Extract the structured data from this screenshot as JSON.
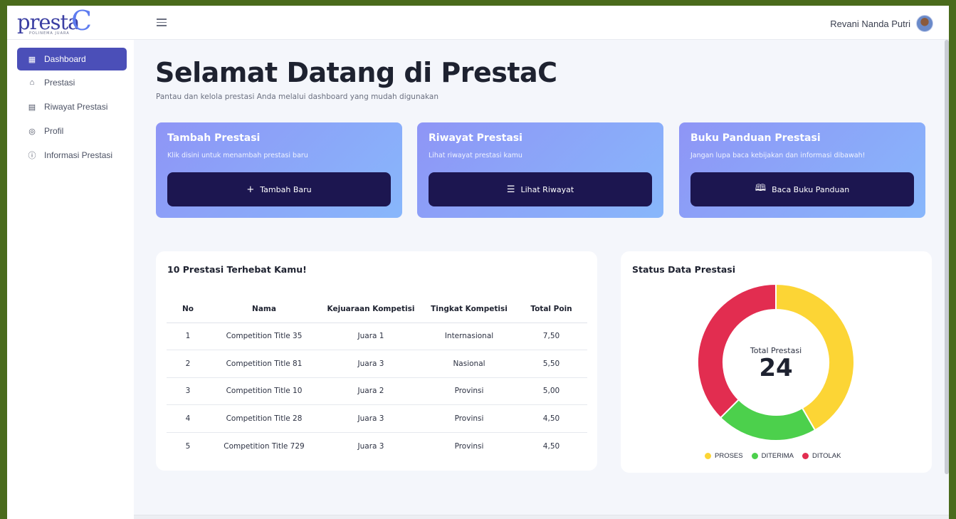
{
  "brand": {
    "name": "presta",
    "letter": "C",
    "tagline": "POLINEMA JUARA"
  },
  "user": {
    "name": "Revani Nanda Putri"
  },
  "sidebar": {
    "items": [
      {
        "label": "Dashboard",
        "icon": "grid-icon",
        "active": true
      },
      {
        "label": "Prestasi",
        "icon": "graduation-cap-icon"
      },
      {
        "label": "Riwayat Prestasi",
        "icon": "history-icon"
      },
      {
        "label": "Profil",
        "icon": "user-circle-icon"
      },
      {
        "label": "Informasi Prestasi",
        "icon": "info-icon"
      }
    ]
  },
  "header": {
    "title": "Selamat Datang di PrestaC",
    "subtitle": "Pantau dan kelola prestasi Anda melalui dashboard yang mudah digunakan"
  },
  "cards": [
    {
      "title": "Tambah Prestasi",
      "desc": "Klik disini untuk menambah prestasi baru",
      "button": "Tambah Baru",
      "icon": "+"
    },
    {
      "title": "Riwayat Prestasi",
      "desc": "Lihat riwayat prestasi kamu",
      "button": "Lihat Riwayat",
      "icon": "☰"
    },
    {
      "title": "Buku Panduan Prestasi",
      "desc": "Jangan lupa baca kebijakan dan informasi dibawah!",
      "button": "Baca Buku Panduan",
      "icon": "🕮"
    }
  ],
  "top_table": {
    "title": "10 Prestasi Terhebat Kamu!",
    "columns": [
      "No",
      "Nama",
      "Kejuaraan Kompetisi",
      "Tingkat Kompetisi",
      "Total Poin"
    ],
    "rows": [
      [
        "1",
        "Competition Title 35",
        "Juara 1",
        "Internasional",
        "7,50"
      ],
      [
        "2",
        "Competition Title 81",
        "Juara 3",
        "Nasional",
        "5,50"
      ],
      [
        "3",
        "Competition Title 10",
        "Juara 2",
        "Provinsi",
        "5,00"
      ],
      [
        "4",
        "Competition Title 28",
        "Juara 3",
        "Provinsi",
        "4,50"
      ],
      [
        "5",
        "Competition Title 729",
        "Juara 3",
        "Provinsi",
        "4,50"
      ]
    ]
  },
  "status_chart": {
    "title": "Status Data Prestasi",
    "center_label": "Total Prestasi",
    "center_value": "24",
    "segments": [
      {
        "name": "PROSES",
        "value": 10,
        "color": "#fcd535"
      },
      {
        "name": "DITERIMA",
        "value": 5,
        "color": "#4cd04c"
      },
      {
        "name": "DITOLAK",
        "value": 9,
        "color": "#e22d50"
      }
    ]
  }
}
